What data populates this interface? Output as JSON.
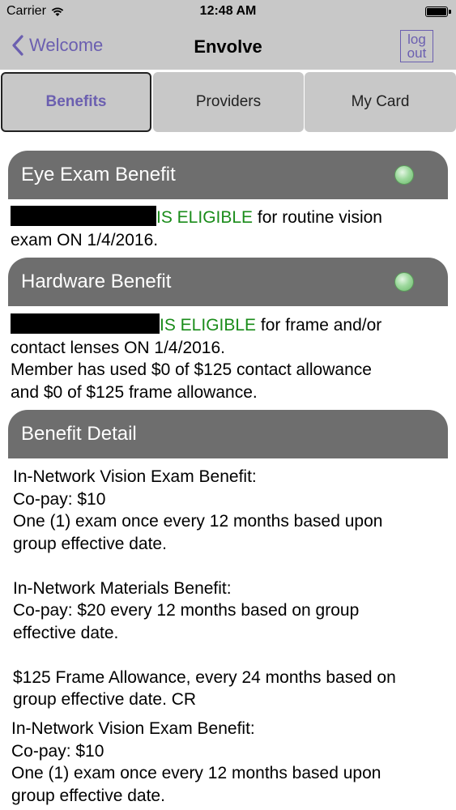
{
  "status_bar": {
    "carrier": "Carrier",
    "time": "12:48 AM"
  },
  "nav": {
    "back_label": "Welcome",
    "title": "Envolve",
    "logout_line1": "log",
    "logout_line2": "out"
  },
  "tabs": [
    {
      "label": "Benefits",
      "active": true
    },
    {
      "label": "Providers",
      "active": false
    },
    {
      "label": "My Card",
      "active": false
    }
  ],
  "eye_exam": {
    "header": "Eye Exam Benefit",
    "status": "IS ELIGIBLE",
    "text_line1": " for routine vision",
    "text_line2": "exam ON 1/4/2016."
  },
  "hardware": {
    "header": "Hardware Benefit",
    "status": "IS ELIGIBLE",
    "text_line1": " for frame and/or",
    "text_line2": "contact lenses ON 1/4/2016.",
    "text_line3": "Member has used $0 of $125 contact allowance",
    "text_line4": "and $0 of $125 frame allowance."
  },
  "detail": {
    "header": "Benefit Detail",
    "lines": [
      "In-Network Vision Exam Benefit:",
      "Co-pay: $10",
      "One (1) exam once every 12 months based upon",
      "group effective date.",
      "",
      "In-Network Materials Benefit:",
      "Co-pay: $20 every 12 months based on group",
      "effective date.",
      "",
      "$125 Frame Allowance, every 24 months based on",
      "group effective date.  CR"
    ],
    "lines2": [
      "In-Network Vision Exam Benefit:",
      "Co-pay: $10",
      "One (1) exam once every 12 months based upon",
      "group effective date."
    ]
  },
  "colors": {
    "accent": "#6b5fb0",
    "eligible": "#1a8c1a",
    "header_bg": "#6e6e6e",
    "bar_bg": "#c8c8c8"
  }
}
